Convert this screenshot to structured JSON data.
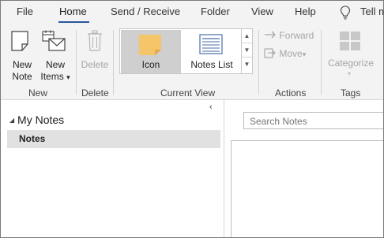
{
  "tabs": [
    {
      "label": "File"
    },
    {
      "label": "Home",
      "active": true
    },
    {
      "label": "Send / Receive"
    },
    {
      "label": "Folder"
    },
    {
      "label": "View"
    },
    {
      "label": "Help"
    },
    {
      "label": "Tell m"
    }
  ],
  "ribbon": {
    "new_group": {
      "label": "New",
      "new_note": {
        "line1": "New",
        "line2": "Note"
      },
      "new_items": {
        "line1": "New",
        "line2": "Items",
        "caret": "▾"
      }
    },
    "delete_group": {
      "label": "Delete",
      "delete_label": "Delete"
    },
    "current_view_group": {
      "label": "Current View",
      "views": [
        {
          "label": "Icon",
          "selected": true
        },
        {
          "label": "Notes List",
          "selected": false
        }
      ]
    },
    "actions_group": {
      "label": "Actions",
      "forward_label": "Forward",
      "move_label": "Move",
      "move_caret": "▾"
    },
    "tags_group": {
      "label": "Tags",
      "categorize_label": "Categorize"
    }
  },
  "nav": {
    "collapse_glyph": "‹",
    "header": "My Notes",
    "header_glyph": "◢",
    "items": [
      {
        "label": "Notes",
        "selected": true
      }
    ]
  },
  "search": {
    "placeholder": "Search Notes"
  },
  "colors": {
    "accent": "#2b579a",
    "note_yellow": "#f5c56a",
    "ribbon_bg": "#f3f3f3"
  },
  "icons": [
    "new-note-icon",
    "new-items-icon",
    "trash-icon",
    "sticky-note-icon",
    "notes-list-icon",
    "forward-icon",
    "move-icon",
    "categorize-icon",
    "lightbulb-icon"
  ]
}
